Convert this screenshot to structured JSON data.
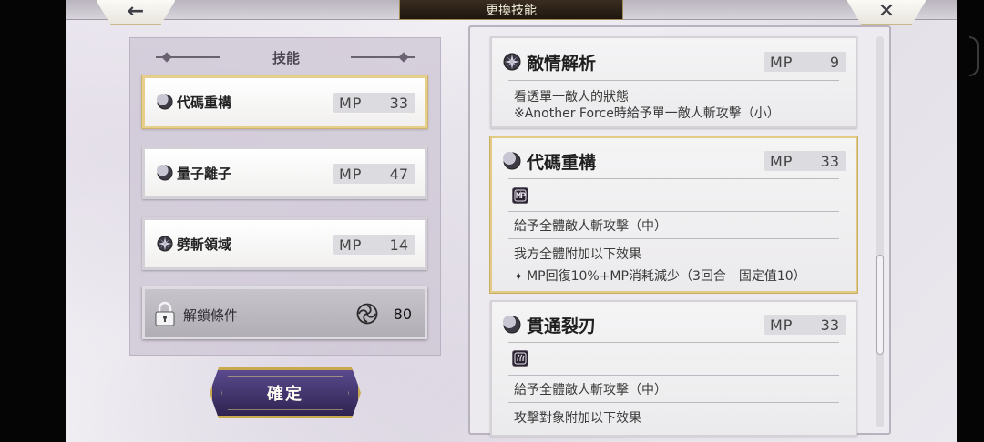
{
  "header": {
    "title": "更換技能",
    "back_glyph": "←",
    "close_glyph": "✕"
  },
  "left": {
    "section_title": "技能",
    "skills": [
      {
        "name": "代碼重構",
        "mp_label": "MP",
        "mp": "33",
        "icon": "moon-orb-icon",
        "selected": true
      },
      {
        "name": "量子離子",
        "mp_label": "MP",
        "mp": "47",
        "icon": "moon-orb-icon",
        "selected": false
      },
      {
        "name": "劈斬領域",
        "mp_label": "MP",
        "mp": "14",
        "icon": "star-burst-icon",
        "selected": false
      }
    ],
    "unlock": {
      "label": "解鎖條件",
      "value": "80",
      "icon": "spiral-icon"
    },
    "confirm_label": "確定"
  },
  "right": {
    "cards": [
      {
        "title": "敵情解析",
        "mp_label": "MP",
        "mp": "9",
        "icon": "star-burst-icon",
        "lines": [
          "看透單一敵人的狀態",
          "※Another Force時給予單一敵人斬攻擊（小）"
        ]
      },
      {
        "title": "代碼重構",
        "mp_label": "MP",
        "mp": "33",
        "icon": "moon-orb-icon",
        "chip": "mp-buff-icon",
        "lines": [
          "給予全體敵人斬攻擊（中）",
          "我方全體附加以下效果",
          "MP回復10%+MP消耗減少（3回合　固定值10）"
        ]
      },
      {
        "title": "貫通裂刃",
        "mp_label": "MP",
        "mp": "33",
        "icon": "moon-orb-icon",
        "chip": "claw-debuff-icon",
        "lines": [
          "給予全體敵人斬攻擊（中）",
          "攻擊對象附加以下效果"
        ]
      }
    ]
  },
  "colors": {
    "selected_border": "#e6cf8a",
    "confirm_bg": "#3f3270",
    "title_plate": "#2a2017"
  }
}
